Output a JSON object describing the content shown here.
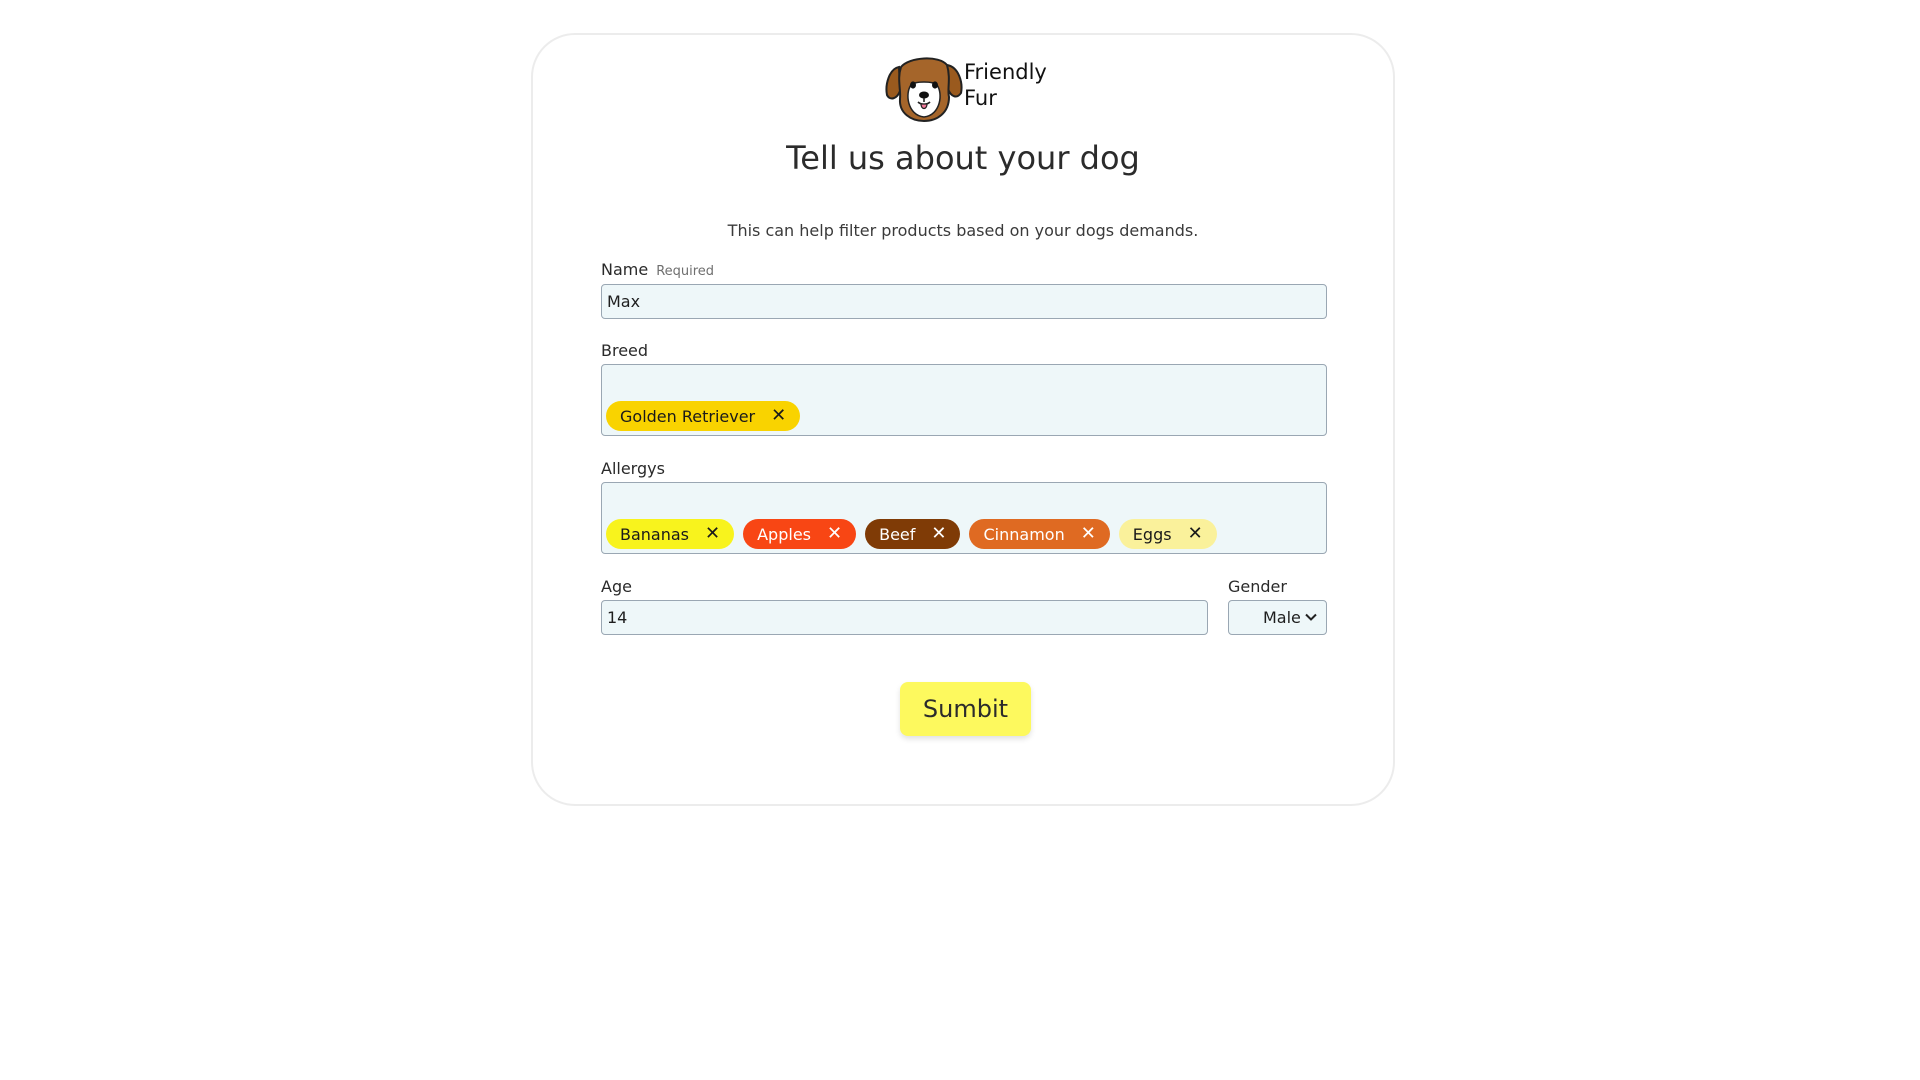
{
  "brand": {
    "name": "Friendly\nFur",
    "logo_icon": "dog-face-icon"
  },
  "form": {
    "title": "Tell us about your dog",
    "subtitle": "This can help filter products based on your dogs demands.",
    "name": {
      "label": "Name",
      "hint": "Required",
      "value": "Max"
    },
    "breed": {
      "label": "Breed",
      "tags": [
        {
          "label": "Golden Retriever",
          "bg": "#f9d300",
          "fg": "#1a1a1a"
        }
      ]
    },
    "allergys": {
      "label": "Allergys",
      "tags": [
        {
          "label": "Bananas",
          "bg": "#f8f31d",
          "fg": "#1a1a1a"
        },
        {
          "label": "Apples",
          "bg": "#f84614",
          "fg": "#ffffff"
        },
        {
          "label": "Beef",
          "bg": "#7f3b06",
          "fg": "#ffffff"
        },
        {
          "label": "Cinnamon",
          "bg": "#df6a22",
          "fg": "#ffffff"
        },
        {
          "label": "Eggs",
          "bg": "#faf19b",
          "fg": "#1a1a1a"
        }
      ]
    },
    "age": {
      "label": "Age",
      "value": "14"
    },
    "gender": {
      "label": "Gender",
      "value": "Male",
      "icon": "chevron-down-icon"
    },
    "submit_label": "Sumbit"
  },
  "colors": {
    "input_bg": "#eef7f9",
    "input_border": "#9aa7b3",
    "submit_bg": "#fdf95e",
    "dog_brown": "#9a5a1e"
  }
}
